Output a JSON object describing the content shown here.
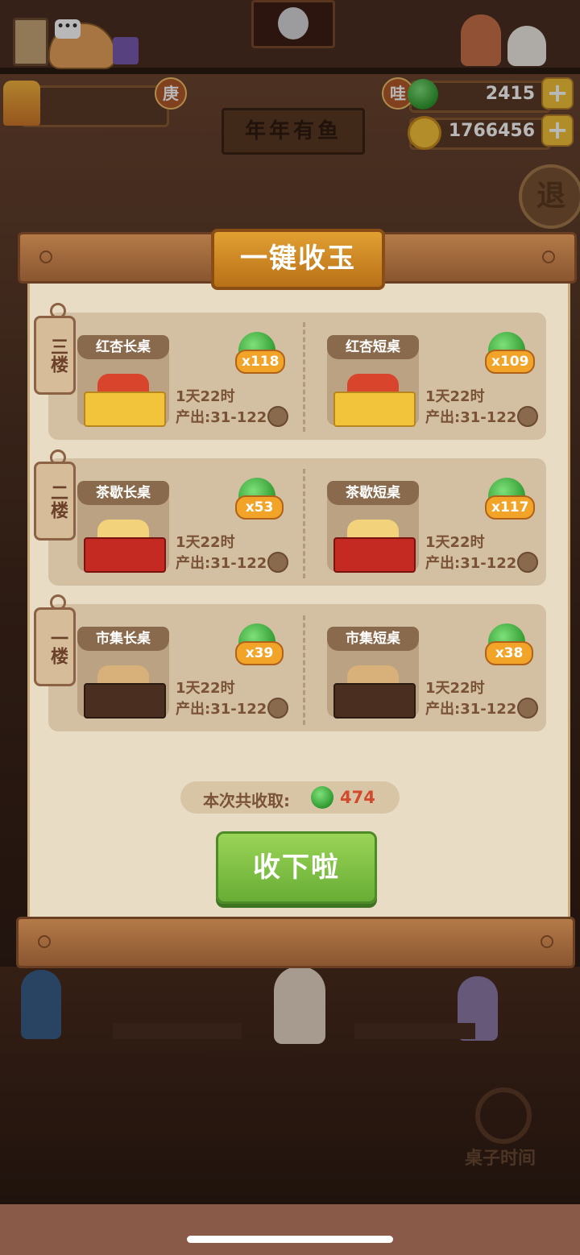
{
  "hud": {
    "jade_badge": "哇",
    "jade_value": "2415",
    "coin_value": "1766456",
    "add_label": "+",
    "level_badge": "庚",
    "exit_label": "退"
  },
  "scene": {
    "shop_sign": "年年有鱼",
    "clock_label": "桌子时间"
  },
  "modal": {
    "title": "一键收玉",
    "floors": [
      {
        "label": "三楼",
        "tables": [
          {
            "name": "红杏长桌",
            "count": "x118",
            "time": "1天22时",
            "output": "产出:31-122"
          },
          {
            "name": "红杏短桌",
            "count": "x109",
            "time": "1天22时",
            "output": "产出:31-122"
          }
        ]
      },
      {
        "label": "二楼",
        "tables": [
          {
            "name": "茶歇长桌",
            "count": "x53",
            "time": "1天22时",
            "output": "产出:31-122"
          },
          {
            "name": "茶歇短桌",
            "count": "x117",
            "time": "1天22时",
            "output": "产出:31-122"
          }
        ]
      },
      {
        "label": "一楼",
        "tables": [
          {
            "name": "市集长桌",
            "count": "x39",
            "time": "1天22时",
            "output": "产出:31-122"
          },
          {
            "name": "市集短桌",
            "count": "x38",
            "time": "1天22时",
            "output": "产出:31-122"
          }
        ]
      }
    ],
    "total_label": "本次共收取:",
    "total_value": "474",
    "collect_button": "收下啦"
  },
  "icons": {
    "jade": "jade-gem-icon",
    "coin": "coin-icon",
    "seed": "seed-icon",
    "clock": "clock-icon"
  },
  "colors": {
    "panel_bg": "#e9dcc4",
    "card_bg": "#d3c0a2",
    "title_plaque": "#d48a24",
    "collect_button": "#7dbf44",
    "total_value": "#d2492c",
    "count_pill": "#f2a428"
  }
}
